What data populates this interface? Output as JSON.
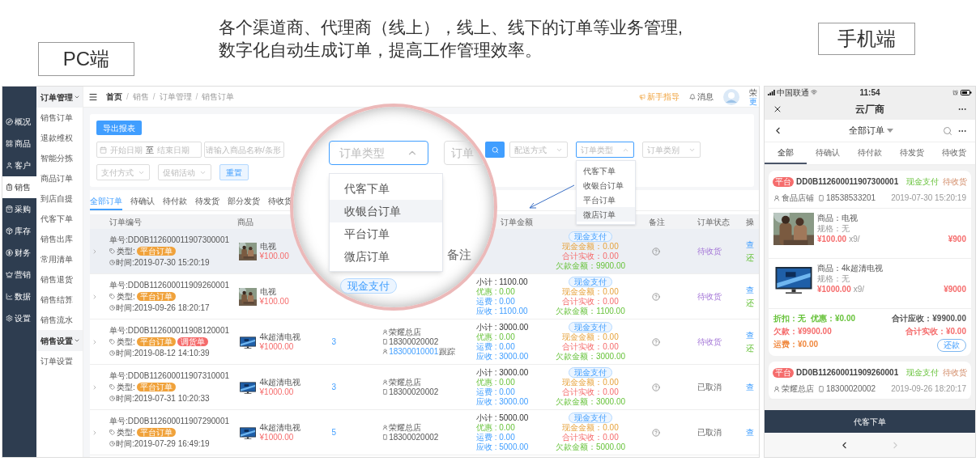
{
  "headline": [
    "各个渠道商、代理商（线上），线上、线下的订单等业务管理,",
    "数字化自动生成订单，提高工作管理效率。"
  ],
  "pc_label": "PC端",
  "mobile_label": "手机端",
  "pc": {
    "nav": [
      {
        "label": "概况",
        "selected": false
      },
      {
        "label": "商品",
        "selected": false
      },
      {
        "label": "客户",
        "selected": false
      },
      {
        "label": "销售",
        "selected": true
      },
      {
        "label": "采购",
        "selected": false
      },
      {
        "label": "库存",
        "selected": false
      },
      {
        "label": "财务",
        "selected": false
      },
      {
        "label": "营销",
        "selected": false
      },
      {
        "label": "数据",
        "selected": false
      },
      {
        "label": "设置",
        "selected": false
      }
    ],
    "subnav": [
      {
        "kind": "group",
        "label": "订单管理"
      },
      {
        "kind": "item",
        "label": "销售订单"
      },
      {
        "kind": "item",
        "label": "退款维权"
      },
      {
        "kind": "item",
        "label": "智能分拣"
      },
      {
        "kind": "item",
        "label": "商品订单"
      },
      {
        "kind": "item",
        "label": "到店自提"
      },
      {
        "kind": "item",
        "label": "代客下单"
      },
      {
        "kind": "item",
        "label": "销售出库"
      },
      {
        "kind": "item",
        "label": "常用清单"
      },
      {
        "kind": "item",
        "label": "销售退货"
      },
      {
        "kind": "item",
        "label": "销售结算"
      },
      {
        "kind": "item",
        "label": "销售流水"
      },
      {
        "kind": "group",
        "label": "销售设置"
      },
      {
        "kind": "item",
        "label": "订单设置"
      }
    ],
    "breadcrumb": [
      "首页",
      "销售",
      "订单管理",
      "销售订单"
    ],
    "breadcrumb_separator": "/",
    "guide": "新手指导",
    "messages": "消息",
    "user_name": "荣",
    "user_link": "更",
    "export_button": "导出报表",
    "date_range": {
      "start": "开始日期",
      "to": "至",
      "end": "结束日期"
    },
    "search_placeholder": "请输入商品名称/条形",
    "selects": [
      {
        "placeholder": "配送方式",
        "open": false
      },
      {
        "placeholder": "订单类型",
        "open": true
      },
      {
        "placeholder": "订单类别",
        "open": false
      }
    ],
    "dropdown_options": [
      {
        "label": "代客下单",
        "highlighted": false
      },
      {
        "label": "收银台订单",
        "highlighted": false
      },
      {
        "label": "平台订单",
        "highlighted": false
      },
      {
        "label": "微店订单",
        "highlighted": true
      }
    ],
    "filters2": [
      {
        "placeholder": "支付方式"
      },
      {
        "placeholder": "促销活动"
      }
    ],
    "reset_button": "重置",
    "tabs": [
      {
        "label": "全部订单",
        "selected": true
      },
      {
        "label": "待确认",
        "selected": false
      },
      {
        "label": "待付款",
        "selected": false
      },
      {
        "label": "待发货",
        "selected": false
      },
      {
        "label": "部分发货",
        "selected": false
      },
      {
        "label": "待收货",
        "selected": false
      }
    ],
    "columns": {
      "order": "订单编号",
      "goods": "商品",
      "amount": "订单金额",
      "notes": "备注",
      "status": "订单状态",
      "ops": "操"
    },
    "rows": [
      {
        "highlighted": true,
        "number": "单号:DD0B112600011907300001",
        "type_label": "类型:",
        "tags": [
          {
            "label": "平台订单",
            "color": "#f0a23b"
          }
        ],
        "time": "时间:2019-07-30 15:20:19",
        "goods": {
          "kind": "picture",
          "name": "电视",
          "price": "¥100.00"
        },
        "payment": {
          "tag": "现金支付",
          "lines": [
            {
              "kind": "cash",
              "text": "现金金额：0.00"
            },
            {
              "kind": "received",
              "text": "合计实收：0.00"
            },
            {
              "kind": "debt",
              "text": "欠款金额：9900.00"
            }
          ]
        },
        "status": {
          "kind": "pending",
          "text": "待收货"
        },
        "ops": [
          {
            "kind": "view",
            "label": "查"
          },
          {
            "kind": "repay",
            "label": "还"
          }
        ]
      },
      {
        "highlighted": false,
        "number": "单号:DD0B112600011909260001",
        "type_label": "类型:",
        "tags": [
          {
            "label": "平台订单",
            "color": "#f0a23b"
          }
        ],
        "time": "时间:2019-09-26 18:20:17",
        "goods": {
          "kind": "picture",
          "name": "电视",
          "price": "¥100.00"
        },
        "amount": [
          {
            "kind": "subtotal",
            "text": "小计 : 1100.00"
          },
          {
            "kind": "discount",
            "text": "优惠 : 0.00"
          },
          {
            "kind": "shipping",
            "text": "运费 : 0.00"
          },
          {
            "kind": "receivable",
            "text": "应收 : 1100.00"
          }
        ],
        "payment": {
          "tag": "现金支付",
          "lines": [
            {
              "kind": "cash",
              "text": "现金金额：0.00"
            },
            {
              "kind": "received",
              "text": "合计实收：0.00"
            },
            {
              "kind": "debt",
              "text": "欠款金额：1100.00"
            }
          ]
        },
        "status": {
          "kind": "pending",
          "text": "待收货"
        },
        "ops": [
          {
            "kind": "view",
            "label": "查"
          },
          {
            "kind": "repay",
            "label": "还"
          }
        ]
      },
      {
        "highlighted": false,
        "number": "单号:DD0B112600011908120001",
        "type_label": "类型:",
        "tags": [
          {
            "label": "平台订单",
            "color": "#f0a23b"
          },
          {
            "label": "调货单",
            "color": "#f56c6c"
          }
        ],
        "time": "时间:2019-08-12 14:10:39",
        "goods": {
          "kind": "picture",
          "name": "4k超清电视",
          "price": "¥1000.00"
        },
        "qty": "3",
        "customer": {
          "store": "荣耀总店",
          "phone": "18300020002",
          "follower": "18300010001",
          "follow_label": "跟踪"
        },
        "amount": [
          {
            "kind": "subtotal",
            "text": "小计 : 3000.00"
          },
          {
            "kind": "discount",
            "text": "优惠 : 0.00"
          },
          {
            "kind": "shipping",
            "text": "运费 : 0.00"
          },
          {
            "kind": "receivable",
            "text": "应收 : 3000.00"
          }
        ],
        "payment": {
          "tag": "现金支付",
          "lines": [
            {
              "kind": "cash",
              "text": "现金金额：0.00"
            },
            {
              "kind": "received",
              "text": "合计实收：0.00"
            },
            {
              "kind": "debt",
              "text": "欠款金额：3000.00"
            }
          ]
        },
        "status": {
          "kind": "pending",
          "text": "待收货"
        },
        "ops": [
          {
            "kind": "view",
            "label": "查"
          },
          {
            "kind": "repay",
            "label": "还"
          }
        ]
      },
      {
        "highlighted": false,
        "number": "单号:DD0B112600011907310001",
        "type_label": "类型:",
        "tags": [
          {
            "label": "平台订单",
            "color": "#f0a23b"
          }
        ],
        "time": "时间:2019-07-31 10:20:33",
        "goods": {
          "kind": "picture",
          "name": "4k超清电视",
          "price": "¥1000.00"
        },
        "qty": "3",
        "customer": {
          "store": "荣耀总店",
          "phone": "18300020002"
        },
        "amount": [
          {
            "kind": "subtotal",
            "text": "小计 : 3000.00"
          },
          {
            "kind": "discount",
            "text": "优惠 : 0.00"
          },
          {
            "kind": "shipping",
            "text": "运费 : 0.00"
          },
          {
            "kind": "receivable",
            "text": "应收 : 3000.00"
          }
        ],
        "payment": {
          "tag": "现金支付",
          "lines": [
            {
              "kind": "cash",
              "text": "现金金额：0.00"
            },
            {
              "kind": "received",
              "text": "合计实收：0.00"
            },
            {
              "kind": "debt",
              "text": "欠款金额：3000.00"
            }
          ]
        },
        "status": {
          "kind": "cancelled",
          "text": "已取消"
        },
        "ops": [
          {
            "kind": "view",
            "label": "查"
          }
        ]
      },
      {
        "highlighted": false,
        "number": "单号:DD0B112600011907290001",
        "type_label": "类型:",
        "tags": [
          {
            "label": "平台订单",
            "color": "#f0a23b"
          }
        ],
        "time": "时间:2019-07-29 16:49:19",
        "goods": {
          "kind": "picture",
          "name": "4k超清电视",
          "price": "¥1000.00"
        },
        "qty": "5",
        "customer": {
          "store": "荣耀总店",
          "phone": "18300020002"
        },
        "amount": [
          {
            "kind": "subtotal",
            "text": "小计 : 5000.00"
          },
          {
            "kind": "discount",
            "text": "优惠 : 0.00"
          },
          {
            "kind": "shipping",
            "text": "运费 : 0.00"
          },
          {
            "kind": "receivable",
            "text": "应收 : 5000.00"
          }
        ],
        "payment": {
          "tag": "现金支付",
          "lines": [
            {
              "kind": "cash",
              "text": "现金金额：0.00"
            },
            {
              "kind": "received",
              "text": "合计实收：0.00"
            },
            {
              "kind": "debt",
              "text": "欠款金额：5000.00"
            }
          ]
        },
        "status": {
          "kind": "cancelled",
          "text": "已取消"
        },
        "ops": [
          {
            "kind": "view",
            "label": "查"
          }
        ]
      }
    ],
    "magnifier": {
      "select_placeholder": "订单类型",
      "select_open": true,
      "search_placeholder": "订单",
      "options": [
        {
          "label": "代客下单",
          "highlighted": false
        },
        {
          "label": "收银台订单",
          "highlighted": true
        },
        {
          "label": "平台订单",
          "highlighted": false
        },
        {
          "label": "微店订单",
          "highlighted": false
        }
      ],
      "notes_header": "备注",
      "payment_tag": "现金支付"
    }
  },
  "mobile": {
    "carrier": "中国联通",
    "time": "11:54",
    "title": "云厂商",
    "filter": "全部订单",
    "tabs": [
      {
        "label": "全部",
        "selected": true
      },
      {
        "label": "待确认",
        "selected": false
      },
      {
        "label": "待付款",
        "selected": false
      },
      {
        "label": "待发货",
        "selected": false
      },
      {
        "label": "待收货",
        "selected": false
      }
    ],
    "orders": [
      {
        "source": "平台",
        "number": "DD0B112600011907300001",
        "payment": "现金支付",
        "status": "待收货",
        "store": "食品店铺",
        "phone": "18538533201",
        "time": "2019-07-30 15:20:19",
        "items": [
          {
            "kind": "picture",
            "name": "商品：电视",
            "spec": "规格：无",
            "price": "¥100.00",
            "qty": "x9/",
            "total": "¥900"
          },
          {
            "kind": "picture",
            "name": "商品：4k超清电视",
            "spec": "规格：无",
            "price": "¥1000.00",
            "qty": "x9/",
            "total": "¥9000"
          }
        ],
        "summary": {
          "discount": "折扣：无",
          "coupon": "优惠：¥0.00",
          "receivable": "合计应收：¥9900.00",
          "debt": "欠款：¥9900.00",
          "received": "合计实收：¥0.00",
          "shipping": "运费：¥0.00",
          "repay": "还款"
        }
      },
      {
        "source": "平台",
        "number": "DD0B112600011909260001",
        "payment": "现金支付",
        "status": "待收货",
        "store": "荣耀总店",
        "phone": "18300020002",
        "time": "2019-09-26 18:20:17"
      }
    ],
    "bottom_button": "代客下单",
    "back_disabled": false,
    "forward_disabled": true
  }
}
